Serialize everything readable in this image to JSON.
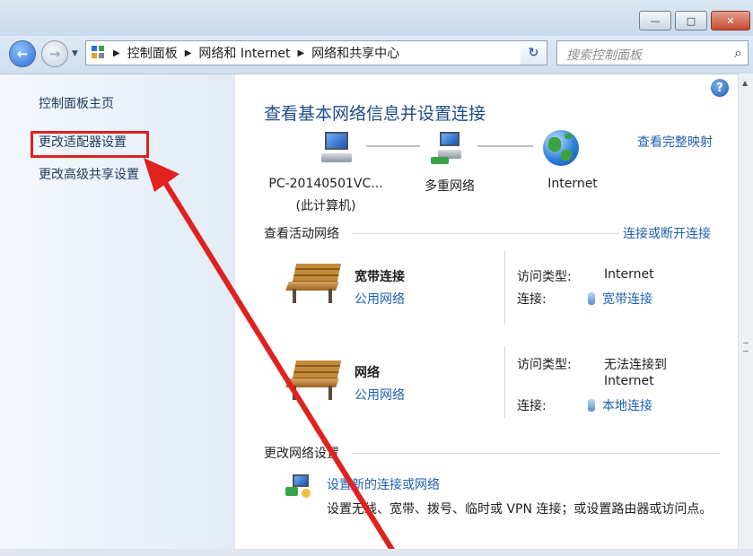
{
  "window": {
    "minimize_glyph": "—",
    "maximize_glyph": "□",
    "close_glyph": "✕"
  },
  "nav": {
    "back_glyph": "←",
    "forward_glyph": "→",
    "breadcrumbs": [
      "控制面板",
      "网络和 Internet",
      "网络和共享中心"
    ],
    "search_placeholder": "搜索控制面板"
  },
  "sidebar": {
    "home": "控制面板主页",
    "adapter_settings": "更改适配器设置",
    "advanced_sharing": "更改高级共享设置"
  },
  "main": {
    "title": "查看基本网络信息并设置连接",
    "full_map": "查看完整映射",
    "nodes": {
      "computer_line1": "PC-20140501VC...",
      "computer_line2": "(此计算机)",
      "network": "多重网络",
      "internet": "Internet"
    },
    "active_networks_label": "查看活动网络",
    "connect_disconnect": "连接或断开连接",
    "networks": [
      {
        "name": "宽带连接",
        "type": "公用网络",
        "access_type_label": "访问类型:",
        "access_type_value": "Internet",
        "connection_label": "连接:",
        "connection_value": "宽带连接"
      },
      {
        "name": "网络",
        "type": "公用网络",
        "access_type_label": "访问类型:",
        "access_type_value_line1": "无法连接到",
        "access_type_value_line2": "Internet",
        "connection_label": "连接:",
        "connection_value": "本地连接"
      }
    ],
    "change_settings_label": "更改网络设置",
    "setup_link": "设置新的连接或网络",
    "setup_desc": "设置无线、宽带、拨号、临时或 VPN 连接；或设置路由器或访问点。"
  },
  "annotation_color": "#e12020"
}
